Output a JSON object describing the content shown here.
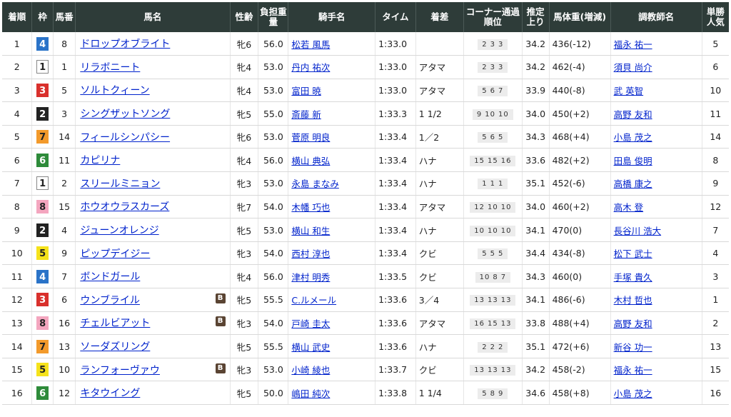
{
  "headers": [
    "着順",
    "枠",
    "馬番",
    "馬名",
    "性齢",
    "負担重量",
    "騎手名",
    "タイム",
    "着差",
    "コーナー通過順位",
    "推定上り",
    "馬体重(増減)",
    "調教師名",
    "単勝人気"
  ],
  "waku_colors": {
    "1": {
      "bg": "#ffffff",
      "fg": "#222222",
      "border": "#888888"
    },
    "2": {
      "bg": "#222222",
      "fg": "#ffffff",
      "border": "#222222"
    },
    "3": {
      "bg": "#d9302c",
      "fg": "#ffffff",
      "border": "#d9302c"
    },
    "4": {
      "bg": "#2a73c8",
      "fg": "#ffffff",
      "border": "#2a73c8"
    },
    "5": {
      "bg": "#f5e21b",
      "fg": "#222222",
      "border": "#f5e21b"
    },
    "6": {
      "bg": "#2e8b3a",
      "fg": "#ffffff",
      "border": "#2e8b3a"
    },
    "7": {
      "bg": "#f39a2b",
      "fg": "#222222",
      "border": "#f39a2b"
    },
    "8": {
      "bg": "#f4a6bf",
      "fg": "#222222",
      "border": "#f4a6bf"
    }
  },
  "blinker_label": "B",
  "rows": [
    {
      "rank": "1",
      "waku": "4",
      "num": "8",
      "horse": "ドロップオブライト",
      "blinker": false,
      "sexage": "牝6",
      "weight": "56.0",
      "jockey": "松若 風馬",
      "time": "1:33.0",
      "margin": "",
      "corners": [
        "2",
        "3",
        "3"
      ],
      "agari": "34.2",
      "body": "436(-12)",
      "trainer": "福永 祐一",
      "pop": "5"
    },
    {
      "rank": "2",
      "waku": "1",
      "num": "1",
      "horse": "リラボニート",
      "blinker": false,
      "sexage": "牝4",
      "weight": "53.0",
      "jockey": "丹内 祐次",
      "time": "1:33.0",
      "margin": "アタマ",
      "corners": [
        "2",
        "3",
        "3"
      ],
      "agari": "34.2",
      "body": "462(-4)",
      "trainer": "須貝 尚介",
      "pop": "6"
    },
    {
      "rank": "3",
      "waku": "3",
      "num": "5",
      "horse": "ソルトクィーン",
      "blinker": false,
      "sexage": "牝4",
      "weight": "53.0",
      "jockey": "富田 暁",
      "time": "1:33.0",
      "margin": "アタマ",
      "corners": [
        "5",
        "6",
        "7"
      ],
      "agari": "33.9",
      "body": "440(-8)",
      "trainer": "武 英智",
      "pop": "10"
    },
    {
      "rank": "4",
      "waku": "2",
      "num": "3",
      "horse": "シングザットソング",
      "blinker": false,
      "sexage": "牝5",
      "weight": "55.0",
      "jockey": "斎藤 新",
      "time": "1:33.3",
      "margin": "1 1/2",
      "corners": [
        "9",
        "10",
        "10"
      ],
      "agari": "34.0",
      "body": "450(+2)",
      "trainer": "高野 友和",
      "pop": "11"
    },
    {
      "rank": "5",
      "waku": "7",
      "num": "14",
      "horse": "フィールシンパシー",
      "blinker": false,
      "sexage": "牝6",
      "weight": "53.0",
      "jockey": "菅原 明良",
      "time": "1:33.4",
      "margin": "1／2",
      "corners": [
        "5",
        "6",
        "5"
      ],
      "agari": "34.3",
      "body": "468(+4)",
      "trainer": "小島 茂之",
      "pop": "14"
    },
    {
      "rank": "6",
      "waku": "6",
      "num": "11",
      "horse": "カピリナ",
      "blinker": false,
      "sexage": "牝4",
      "weight": "56.0",
      "jockey": "横山 典弘",
      "time": "1:33.4",
      "margin": "ハナ",
      "corners": [
        "15",
        "15",
        "16"
      ],
      "agari": "33.6",
      "body": "482(+2)",
      "trainer": "田島 俊明",
      "pop": "8"
    },
    {
      "rank": "7",
      "waku": "1",
      "num": "2",
      "horse": "スリールミニョン",
      "blinker": false,
      "sexage": "牝3",
      "weight": "53.0",
      "jockey": "永島 まなみ",
      "time": "1:33.4",
      "margin": "ハナ",
      "corners": [
        "1",
        "1",
        "1"
      ],
      "agari": "35.1",
      "body": "452(-6)",
      "trainer": "高橋 康之",
      "pop": "9"
    },
    {
      "rank": "8",
      "waku": "8",
      "num": "15",
      "horse": "ホウオウラスカーズ",
      "blinker": false,
      "sexage": "牝7",
      "weight": "54.0",
      "jockey": "木幡 巧也",
      "time": "1:33.4",
      "margin": "アタマ",
      "corners": [
        "12",
        "10",
        "10"
      ],
      "agari": "34.0",
      "body": "460(+2)",
      "trainer": "高木 登",
      "pop": "12"
    },
    {
      "rank": "9",
      "waku": "2",
      "num": "4",
      "horse": "ジューンオレンジ",
      "blinker": false,
      "sexage": "牝5",
      "weight": "53.0",
      "jockey": "横山 和生",
      "time": "1:33.4",
      "margin": "ハナ",
      "corners": [
        "10",
        "10",
        "10"
      ],
      "agari": "34.1",
      "body": "470(0)",
      "trainer": "長谷川 浩大",
      "pop": "7"
    },
    {
      "rank": "10",
      "waku": "5",
      "num": "9",
      "horse": "ピップデイジー",
      "blinker": false,
      "sexage": "牝3",
      "weight": "54.0",
      "jockey": "西村 淳也",
      "time": "1:33.4",
      "margin": "クビ",
      "corners": [
        "5",
        "5",
        "5"
      ],
      "agari": "34.4",
      "body": "434(-8)",
      "trainer": "松下 武士",
      "pop": "4"
    },
    {
      "rank": "11",
      "waku": "4",
      "num": "7",
      "horse": "ボンドガール",
      "blinker": false,
      "sexage": "牝4",
      "weight": "56.0",
      "jockey": "津村 明秀",
      "time": "1:33.5",
      "margin": "クビ",
      "corners": [
        "10",
        "8",
        "7"
      ],
      "agari": "34.3",
      "body": "460(0)",
      "trainer": "手塚 貴久",
      "pop": "3"
    },
    {
      "rank": "12",
      "waku": "3",
      "num": "6",
      "horse": "ウンブライル",
      "blinker": true,
      "sexage": "牝5",
      "weight": "55.5",
      "jockey": "C.ルメール",
      "time": "1:33.6",
      "margin": "3／4",
      "corners": [
        "13",
        "13",
        "13"
      ],
      "agari": "34.1",
      "body": "486(-6)",
      "trainer": "木村 哲也",
      "pop": "1"
    },
    {
      "rank": "13",
      "waku": "8",
      "num": "16",
      "horse": "チェルビアット",
      "blinker": true,
      "sexage": "牝3",
      "weight": "54.0",
      "jockey": "戸崎 圭太",
      "time": "1:33.6",
      "margin": "アタマ",
      "corners": [
        "16",
        "15",
        "13"
      ],
      "agari": "33.8",
      "body": "488(+4)",
      "trainer": "高野 友和",
      "pop": "2"
    },
    {
      "rank": "14",
      "waku": "7",
      "num": "13",
      "horse": "ソーダズリング",
      "blinker": false,
      "sexage": "牝5",
      "weight": "55.5",
      "jockey": "横山 武史",
      "time": "1:33.6",
      "margin": "ハナ",
      "corners": [
        "2",
        "2",
        "2"
      ],
      "agari": "35.1",
      "body": "472(+6)",
      "trainer": "新谷 功一",
      "pop": "13"
    },
    {
      "rank": "15",
      "waku": "5",
      "num": "10",
      "horse": "ランフォーヴァウ",
      "blinker": true,
      "sexage": "牝3",
      "weight": "53.0",
      "jockey": "小崎 綾也",
      "time": "1:33.7",
      "margin": "クビ",
      "corners": [
        "13",
        "13",
        "13"
      ],
      "agari": "34.2",
      "body": "458(-2)",
      "trainer": "福永 祐一",
      "pop": "15"
    },
    {
      "rank": "16",
      "waku": "6",
      "num": "12",
      "horse": "キタウイング",
      "blinker": false,
      "sexage": "牝5",
      "weight": "50.0",
      "jockey": "嶋田 純次",
      "time": "1:33.8",
      "margin": "1 1/4",
      "corners": [
        "5",
        "8",
        "9"
      ],
      "agari": "34.6",
      "body": "458(+8)",
      "trainer": "小島 茂之",
      "pop": "16"
    }
  ]
}
